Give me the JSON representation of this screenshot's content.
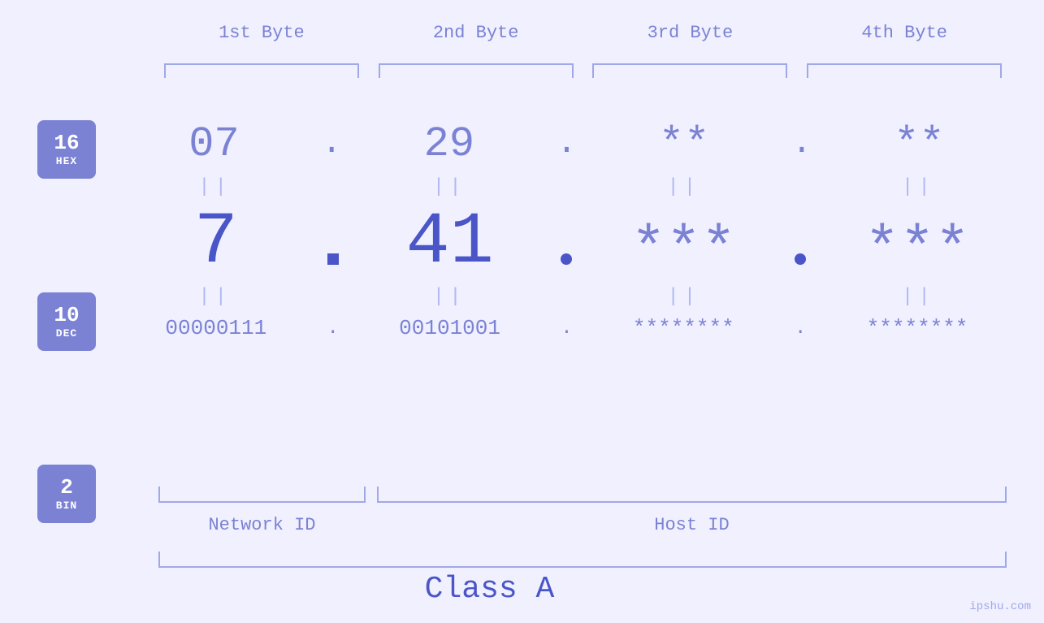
{
  "page": {
    "background": "#f0f0ff",
    "watermark": "ipshu.com"
  },
  "col_headers": {
    "byte1": "1st Byte",
    "byte2": "2nd Byte",
    "byte3": "3rd Byte",
    "byte4": "4th Byte"
  },
  "badges": {
    "hex": {
      "num": "16",
      "label": "HEX"
    },
    "dec": {
      "num": "10",
      "label": "DEC"
    },
    "bin": {
      "num": "2",
      "label": "BIN"
    }
  },
  "hex_row": {
    "b1": "07",
    "b2": "29",
    "b3": "**",
    "b4": "**",
    "dots": "."
  },
  "dec_row": {
    "b1": "7",
    "b2": "41",
    "b3": "***",
    "b4": "***",
    "dots": "."
  },
  "bin_row": {
    "b1": "00000111",
    "b2": "00101001",
    "b3": "********",
    "b4": "********",
    "dots": "."
  },
  "equals": "||",
  "labels": {
    "network_id": "Network ID",
    "host_id": "Host ID",
    "class": "Class A"
  }
}
